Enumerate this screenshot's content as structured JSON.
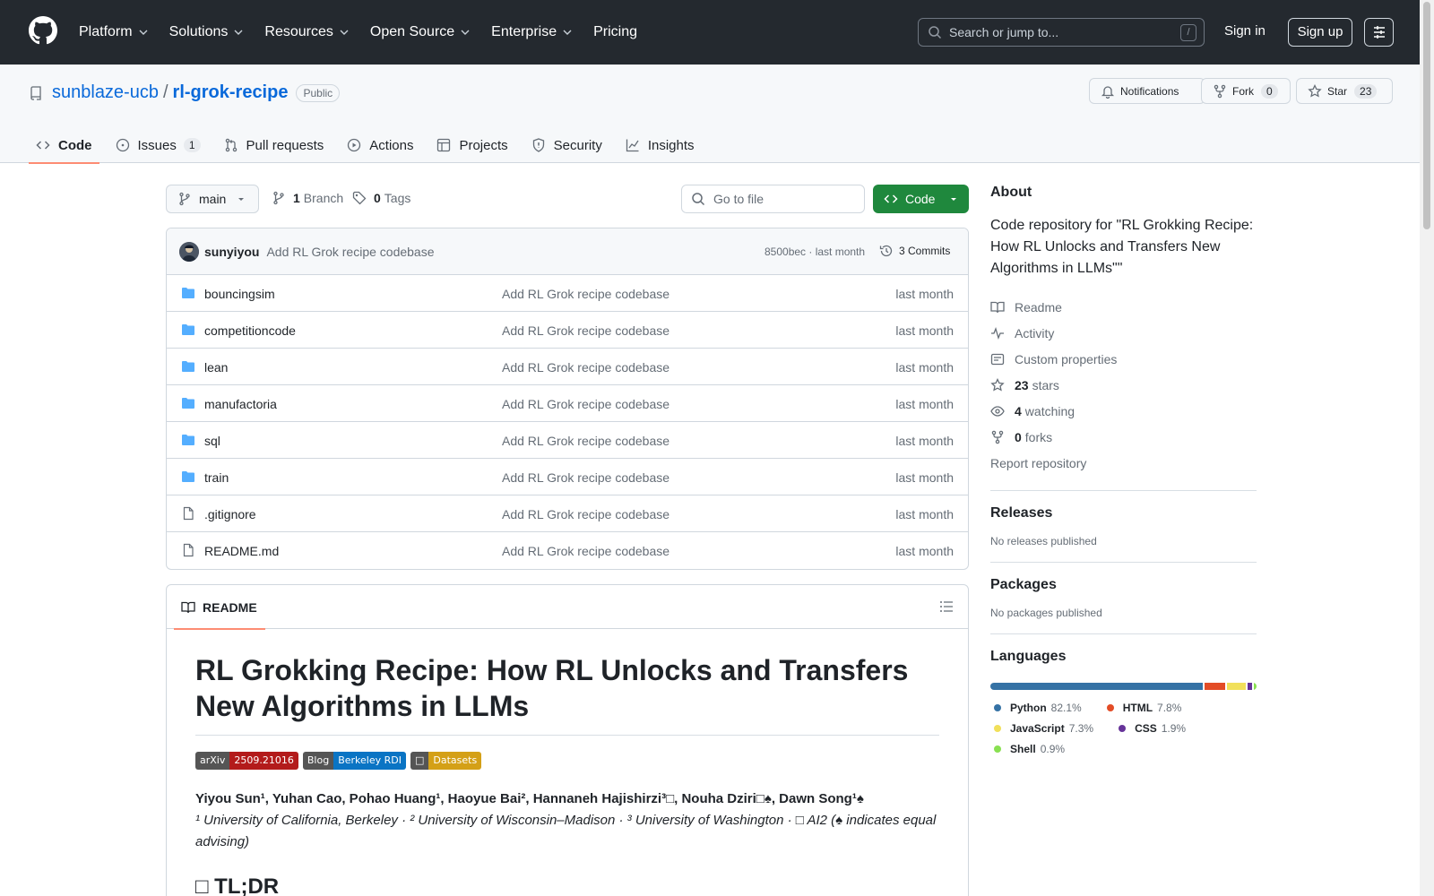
{
  "header": {
    "nav": [
      "Platform",
      "Solutions",
      "Resources",
      "Open Source",
      "Enterprise",
      "Pricing"
    ],
    "search_placeholder": "Search or jump to...",
    "search_shortcut": "/",
    "signin": "Sign in",
    "signup": "Sign up"
  },
  "repo": {
    "owner": "sunblaze-ucb",
    "separator": "/",
    "name": "rl-grok-recipe",
    "visibility": "Public",
    "notifications_label": "Notifications",
    "fork_label": "Fork",
    "fork_count": "0",
    "star_label": "Star",
    "star_count": "23"
  },
  "tabs": [
    {
      "label": "Code",
      "icon": "code-icon"
    },
    {
      "label": "Issues",
      "count": "1",
      "icon": "issue-icon"
    },
    {
      "label": "Pull requests",
      "icon": "pull-request-icon"
    },
    {
      "label": "Actions",
      "icon": "play-icon"
    },
    {
      "label": "Projects",
      "icon": "table-icon"
    },
    {
      "label": "Security",
      "icon": "shield-icon"
    },
    {
      "label": "Insights",
      "icon": "graph-icon"
    }
  ],
  "branchbar": {
    "branch": "main",
    "branch_count": "1",
    "branch_label": "Branch",
    "tag_count": "0",
    "tag_label": "Tags",
    "goto_placeholder": "Go to file",
    "code_button": "Code"
  },
  "commit": {
    "author": "sunyiyou",
    "message": "Add RL Grok recipe codebase",
    "hash_time": "8500bec · last month",
    "commits_label": "3 Commits"
  },
  "files": [
    {
      "name": "bouncingsim",
      "type": "folder",
      "message": "Add RL Grok recipe codebase",
      "date": "last month"
    },
    {
      "name": "competitioncode",
      "type": "folder",
      "message": "Add RL Grok recipe codebase",
      "date": "last month"
    },
    {
      "name": "lean",
      "type": "folder",
      "message": "Add RL Grok recipe codebase",
      "date": "last month"
    },
    {
      "name": "manufactoria",
      "type": "folder",
      "message": "Add RL Grok recipe codebase",
      "date": "last month"
    },
    {
      "name": "sql",
      "type": "folder",
      "message": "Add RL Grok recipe codebase",
      "date": "last month"
    },
    {
      "name": "train",
      "type": "folder",
      "message": "Add RL Grok recipe codebase",
      "date": "last month"
    },
    {
      "name": ".gitignore",
      "type": "file",
      "message": "Add RL Grok recipe codebase",
      "date": "last month"
    },
    {
      "name": "README.md",
      "type": "file",
      "message": "Add RL Grok recipe codebase",
      "date": "last month"
    }
  ],
  "readme": {
    "tab_label": "README",
    "title": "RL Grokking Recipe: How RL Unlocks and Transfers New Algorithms in LLMs",
    "shields": [
      {
        "left": "arXiv",
        "right": "2509.21016",
        "color": "#b31b1b"
      },
      {
        "left": "Blog",
        "right": "Berkeley RDI",
        "color": "#0a74c4"
      },
      {
        "left": "□",
        "right": "Datasets",
        "color": "#d4a017"
      }
    ],
    "authors": "Yiyou Sun¹, Yuhan Cao, Pohao Huang¹, Haoyue Bai², Hannaneh Hajishirzi³□, Nouha Dziri□♠, Dawn Song¹♠",
    "affiliations": "¹ University of California, Berkeley · ² University of Wisconsin–Madison · ³ University of Washington · □ AI2 (♠ indicates equal advising)",
    "tldr": "□ TL;DR"
  },
  "sidebar": {
    "about_heading": "About",
    "description": "Code repository for \"RL Grokking Recipe: How RL Unlocks and Transfers New Algorithms in LLMs\"\"",
    "readme": "Readme",
    "activity": "Activity",
    "custom_properties": "Custom properties",
    "stars_count": "23",
    "stars_label": "stars",
    "watching_count": "4",
    "watching_label": "watching",
    "forks_count": "0",
    "forks_label": "forks",
    "report": "Report repository",
    "releases_heading": "Releases",
    "releases_text": "No releases published",
    "packages_heading": "Packages",
    "packages_text": "No packages published",
    "languages_heading": "Languages"
  },
  "languages": [
    {
      "name": "Python",
      "percent": "82.1%",
      "value": 82.1,
      "color": "#3572A5"
    },
    {
      "name": "HTML",
      "percent": "7.8%",
      "value": 7.8,
      "color": "#e34c26"
    },
    {
      "name": "JavaScript",
      "percent": "7.3%",
      "value": 7.3,
      "color": "#f1e05a"
    },
    {
      "name": "CSS",
      "percent": "1.9%",
      "value": 1.9,
      "color": "#663399"
    },
    {
      "name": "Shell",
      "percent": "0.9%",
      "value": 0.9,
      "color": "#89e051"
    }
  ]
}
